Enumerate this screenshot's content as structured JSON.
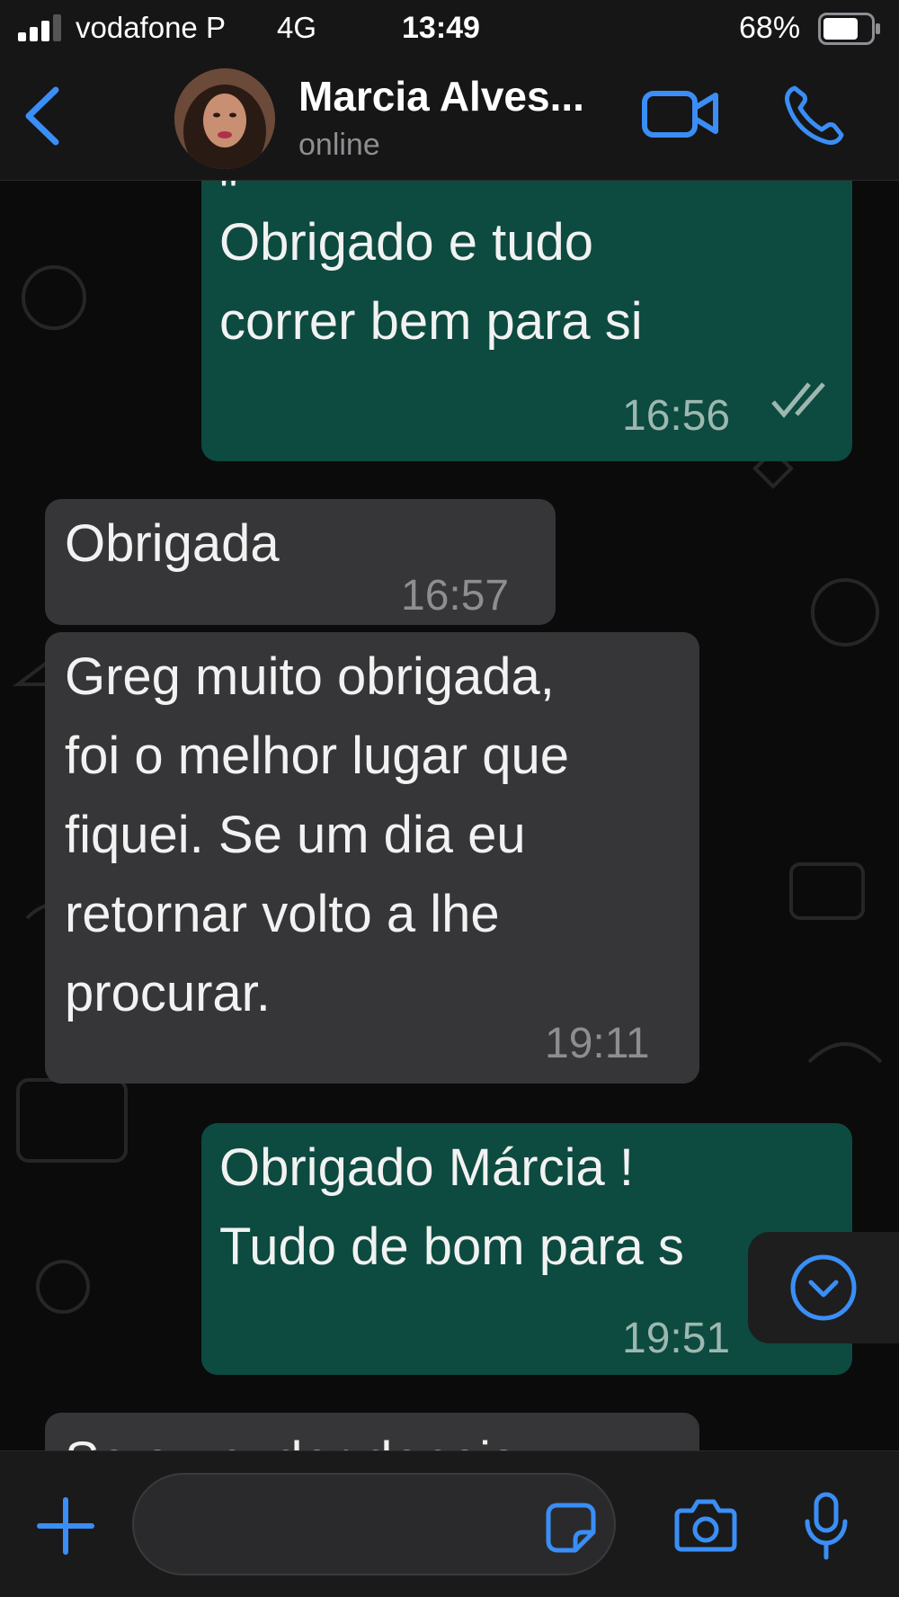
{
  "status_bar": {
    "carrier": "vodafone P",
    "network": "4G",
    "time": "13:49",
    "battery_percent": "68%",
    "signal_bars": 3,
    "signal_bars_max": 4
  },
  "header": {
    "contact_name": "Marcia Alves...",
    "status": "online",
    "back_icon": "chevron-left-icon",
    "video_icon": "video-camera-icon",
    "call_icon": "phone-icon"
  },
  "messages": [
    {
      "direction": "out",
      "lines": [
        "\"",
        "Obrigado e tudo",
        "correr bem para si"
      ],
      "time": "16:56",
      "read": true
    },
    {
      "direction": "in",
      "lines": [
        "Obrigada"
      ],
      "time": "16:57"
    },
    {
      "direction": "in",
      "lines": [
        "Greg muito obrigada,",
        "foi o melhor lugar que",
        "fiquei. Se um dia eu",
        "retornar volto a lhe",
        "procurar."
      ],
      "time": "19:11"
    },
    {
      "direction": "out",
      "lines": [
        "Obrigado Márcia !",
        "Tudo de bom para s"
      ],
      "time": "19:51",
      "read": true
    },
    {
      "direction": "in",
      "lines": [
        "Se eu puder depois"
      ],
      "time": ""
    }
  ],
  "composer": {
    "placeholder": "",
    "plus_icon": "plus-icon",
    "sticker_icon": "sticker-icon",
    "camera_icon": "camera-icon",
    "mic_icon": "microphone-icon"
  },
  "scroll_button_icon": "chevron-down-circle-icon",
  "colors": {
    "accent": "#3a8ef5",
    "outgoing_bubble": "#0d4a3f",
    "incoming_bubble": "#363638",
    "background": "#0b0b0b",
    "read_ticks": "#9db8b0"
  }
}
